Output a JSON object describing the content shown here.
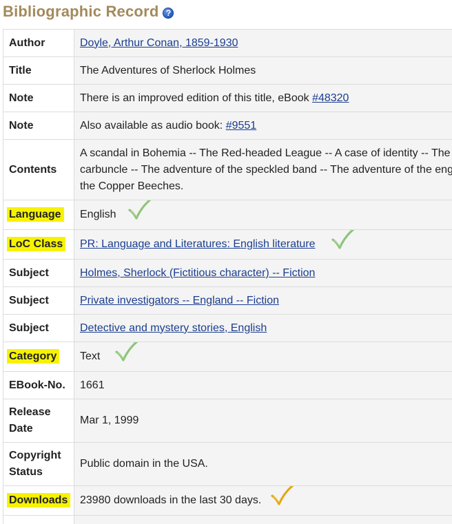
{
  "header": {
    "title": "Bibliographic Record",
    "help_icon_glyph": "?"
  },
  "colors": {
    "title": "#a38a5c",
    "highlight": "#f7f300",
    "check_green": "#8fc47a",
    "check_orange": "#e0a818",
    "link": "#1a3d8f"
  },
  "record": {
    "author": {
      "label": "Author",
      "value": "Doyle, Arthur Conan, 1859-1930"
    },
    "title": {
      "label": "Title",
      "value": "The Adventures of Sherlock Holmes"
    },
    "note1": {
      "label": "Note",
      "text": "There is an improved edition of this title, eBook ",
      "link": "#48320"
    },
    "note2": {
      "label": "Note",
      "text": "Also available as audio book: ",
      "link": "#9551"
    },
    "contents": {
      "label": "Contents",
      "lines": [
        "A scandal in Bohemia -- The Red-headed League -- A case of identity -- The",
        "carbuncle -- The adventure of the speckled band -- The adventure of the eng",
        "the Copper Beeches."
      ]
    },
    "language": {
      "label": "Language",
      "value": "English",
      "check_icon": "green-check-icon"
    },
    "loc_class": {
      "label": "LoC Class",
      "value": "PR: Language and Literatures: English literature",
      "check_icon": "green-check-icon"
    },
    "subjects": [
      {
        "label": "Subject",
        "value": "Holmes, Sherlock (Fictitious character) -- Fiction"
      },
      {
        "label": "Subject",
        "value": "Private investigators -- England -- Fiction"
      },
      {
        "label": "Subject",
        "value": "Detective and mystery stories, English"
      }
    ],
    "category": {
      "label": "Category",
      "value": "Text",
      "check_icon": "green-check-icon"
    },
    "ebook_no": {
      "label": "EBook-No.",
      "value": "1661"
    },
    "release_date": {
      "label_line1": "Release",
      "label_line2": "Date",
      "value": "Mar 1, 1999"
    },
    "copyright": {
      "label_line1": "Copyright",
      "label_line2": "Status",
      "value": "Public domain in the USA."
    },
    "downloads": {
      "label": "Downloads",
      "value": "23980 downloads in the last 30 days.",
      "check_icon": "orange-check-icon"
    }
  }
}
